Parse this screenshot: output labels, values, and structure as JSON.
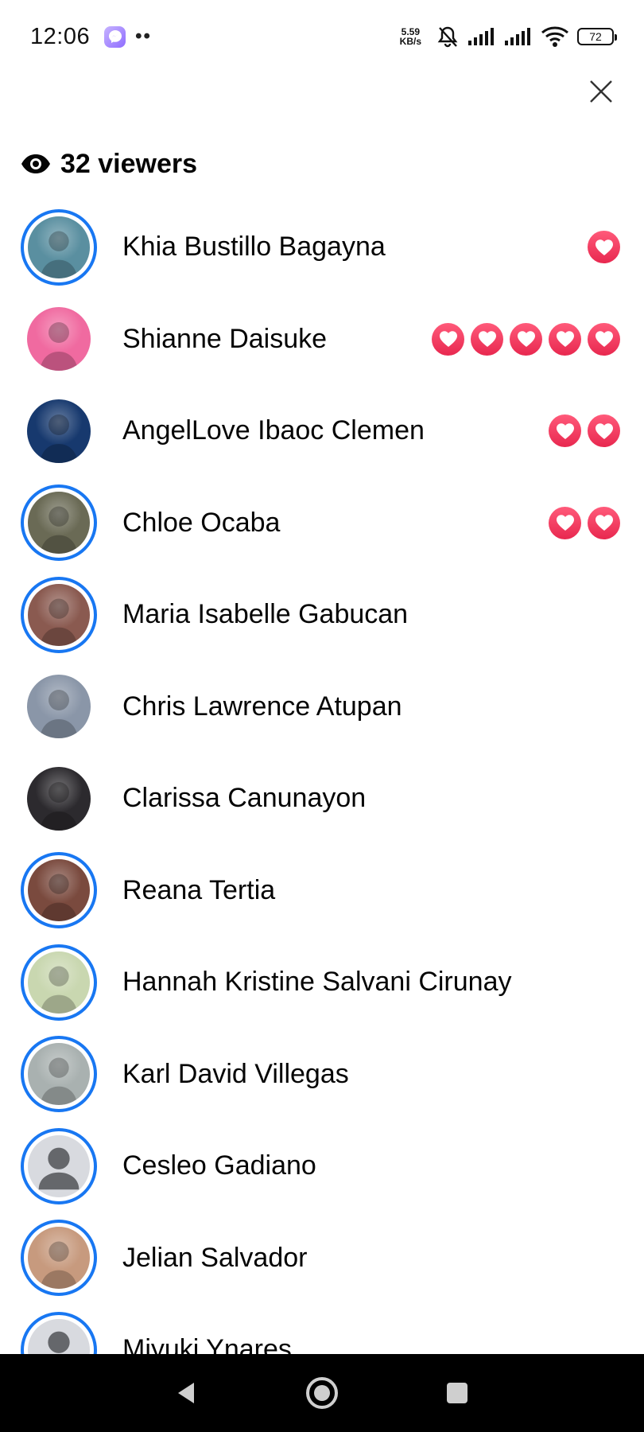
{
  "status_bar": {
    "time": "12:06",
    "dots": "••",
    "net_speed_value": "5.59",
    "net_speed_unit": "KB/s",
    "battery": "72"
  },
  "header": {
    "viewers_label": "32 viewers"
  },
  "viewers": [
    {
      "name": "Khia Bustillo Bagayna",
      "ring": true,
      "hearts": 1,
      "avatar_color": "#5a8fa0"
    },
    {
      "name": "Shianne Daisuke",
      "ring": false,
      "hearts": 5,
      "avatar_color": "#f06aa0"
    },
    {
      "name": "AngelLove Ibaoc Clemen",
      "ring": false,
      "hearts": 2,
      "avatar_color": "#17396e"
    },
    {
      "name": "Chloe Ocaba",
      "ring": true,
      "hearts": 2,
      "avatar_color": "#6a6a55"
    },
    {
      "name": "Maria Isabelle Gabucan",
      "ring": true,
      "hearts": 0,
      "avatar_color": "#8a5a50"
    },
    {
      "name": "Chris Lawrence Atupan",
      "ring": false,
      "hearts": 0,
      "avatar_color": "#8a96a8"
    },
    {
      "name": "Clarissa Canunayon",
      "ring": false,
      "hearts": 0,
      "avatar_color": "#2c2a2e"
    },
    {
      "name": "Reana Tertia",
      "ring": true,
      "hearts": 0,
      "avatar_color": "#7a4a3e"
    },
    {
      "name": "Hannah Kristine Salvani Cirunay",
      "ring": true,
      "hearts": 0,
      "avatar_color": "#c9d7b0"
    },
    {
      "name": "Karl David Villegas",
      "ring": true,
      "hearts": 0,
      "avatar_color": "#a9b1b0"
    },
    {
      "name": "Cesleo Gadiano",
      "ring": true,
      "hearts": 0,
      "avatar_color": "#d8dadf",
      "placeholder": true
    },
    {
      "name": "Jelian Salvador",
      "ring": true,
      "hearts": 0,
      "avatar_color": "#c79a7e"
    },
    {
      "name": "Miyuki Ynares",
      "ring": true,
      "hearts": 0,
      "avatar_color": "#d8dadf",
      "placeholder": true
    }
  ],
  "colors": {
    "ring": "#1877f2",
    "heart": "#f02849",
    "text": "#050505"
  }
}
